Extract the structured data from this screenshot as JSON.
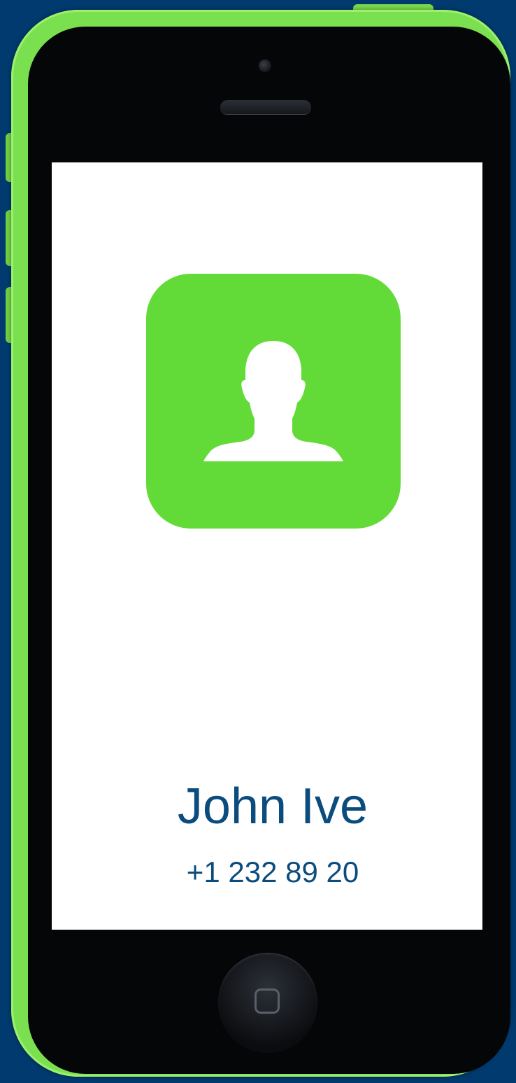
{
  "contact": {
    "name": "John Ive",
    "phone": "+1 232 89 20"
  },
  "colors": {
    "background": "#003a6e",
    "phone_frame": "#7be04f",
    "avatar_tile": "#62db39",
    "text": "#0b4c7e"
  },
  "icons": {
    "avatar": "person-silhouette-icon",
    "home": "home-button-icon"
  }
}
